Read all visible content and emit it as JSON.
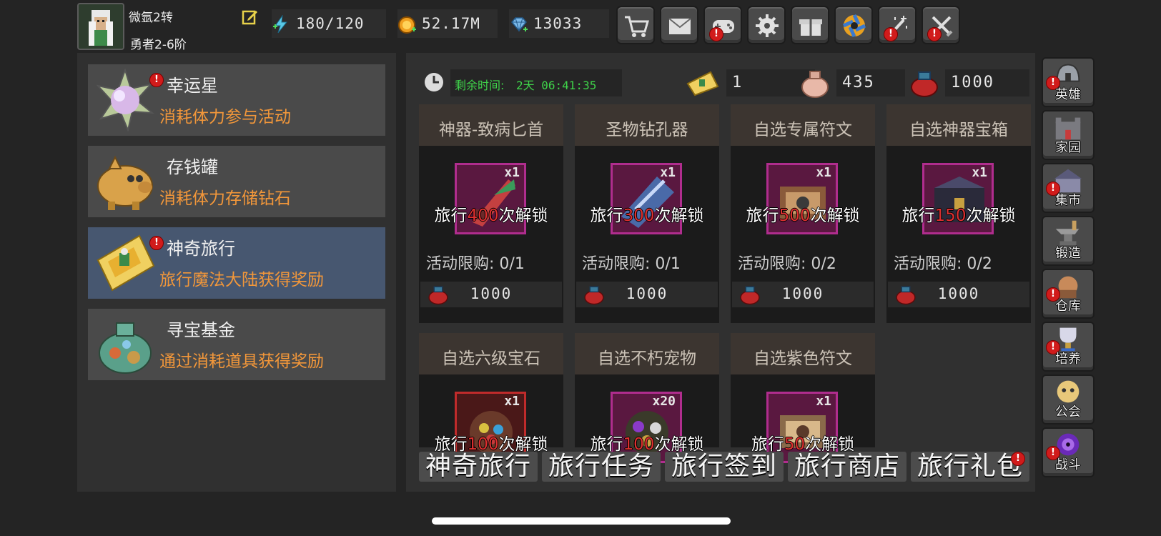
{
  "player": {
    "name": "微氩2转",
    "rank": "勇者2-6阶"
  },
  "resources": {
    "stamina": "180/120",
    "gold": "52.17M",
    "diamonds": "13033"
  },
  "toolbar": [
    {
      "icon": "cart-icon",
      "badge": false
    },
    {
      "icon": "mail-icon",
      "badge": false
    },
    {
      "icon": "gamepad-icon",
      "badge": true
    },
    {
      "icon": "gear-icon",
      "badge": false
    },
    {
      "icon": "gift-icon",
      "badge": false
    },
    {
      "icon": "camera-shutter-icon",
      "badge": false
    },
    {
      "icon": "wand-icon",
      "badge": true
    },
    {
      "icon": "crossed-swords-icon",
      "badge": true
    }
  ],
  "events": [
    {
      "title": "幸运星",
      "desc": "消耗体力参与活动",
      "badge": true
    },
    {
      "title": "存钱罐",
      "desc": "消耗体力存储钻石",
      "badge": false
    },
    {
      "title": "神奇旅行",
      "desc": "旅行魔法大陆获得奖励",
      "badge": true,
      "active": true
    },
    {
      "title": "寻宝基金",
      "desc": "通过消耗道具获得奖励",
      "badge": false
    }
  ],
  "timer": {
    "label": "剩余时间:",
    "value": "2天 06:41:35"
  },
  "currencies": {
    "ticket": "1",
    "pouch": "435",
    "bag": "1000"
  },
  "shop_items": [
    {
      "name": "神器-致病匕首",
      "qty": "x1",
      "unlock_prefix": "旅行",
      "unlock_count": "400",
      "unlock_suffix": "次解锁",
      "limit": "活动限购: 0/1",
      "price": "1000"
    },
    {
      "name": "圣物钻孔器",
      "qty": "x1",
      "unlock_prefix": "旅行",
      "unlock_count": "300",
      "unlock_suffix": "次解锁",
      "limit": "活动限购: 0/1",
      "price": "1000"
    },
    {
      "name": "自选专属符文",
      "qty": "x1",
      "unlock_prefix": "旅行",
      "unlock_count": "500",
      "unlock_suffix": "次解锁",
      "limit": "活动限购: 0/2",
      "price": "1000"
    },
    {
      "name": "自选神器宝箱",
      "qty": "x1",
      "unlock_prefix": "旅行",
      "unlock_count": "150",
      "unlock_suffix": "次解锁",
      "limit": "活动限购: 0/2",
      "price": "1000"
    },
    {
      "name": "自选六级宝石",
      "qty": "x1",
      "unlock_prefix": "旅行",
      "unlock_count": "100",
      "unlock_suffix": "次解锁"
    },
    {
      "name": "自选不朽宠物",
      "qty": "x20",
      "unlock_prefix": "旅行",
      "unlock_count": "100",
      "unlock_suffix": "次解锁"
    },
    {
      "name": "自选紫色符文",
      "qty": "x1",
      "unlock_prefix": "旅行",
      "unlock_count": "50",
      "unlock_suffix": "次解锁"
    }
  ],
  "tabs": [
    "神奇旅行",
    "旅行任务",
    "旅行签到",
    "旅行商店",
    "旅行礼包"
  ],
  "side_nav": [
    {
      "label": "英雄",
      "icon": "helmet-icon",
      "badge": true
    },
    {
      "label": "家园",
      "icon": "castle-icon",
      "badge": false
    },
    {
      "label": "集市",
      "icon": "market-icon",
      "badge": true
    },
    {
      "label": "锻造",
      "icon": "anvil-icon",
      "badge": false
    },
    {
      "label": "仓库",
      "icon": "warehouse-icon",
      "badge": true
    },
    {
      "label": "培养",
      "icon": "trophy-icon",
      "badge": true
    },
    {
      "label": "公会",
      "icon": "guild-icon",
      "badge": false
    },
    {
      "label": "战斗",
      "icon": "portal-icon",
      "badge": true
    }
  ],
  "colors": {
    "accent_orange": "#f2973a",
    "timer_green": "#3fd34a",
    "unlock_red": "#e03030",
    "active_row": "#475770",
    "badge_red": "#d11b1b"
  }
}
